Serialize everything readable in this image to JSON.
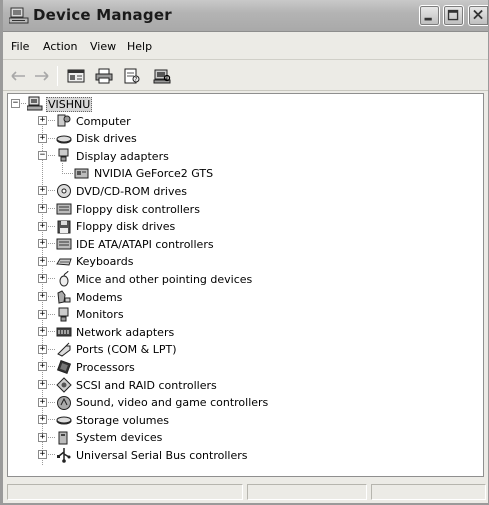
{
  "window": {
    "title": "Device Manager"
  },
  "menu": [
    "File",
    "Action",
    "View",
    "Help"
  ],
  "toolbar": {
    "back_icon": "back-arrow-icon",
    "forward_icon": "forward-arrow-icon",
    "show_hide_tree_icon": "console-tree-icon",
    "print_icon": "printer-icon",
    "properties_icon": "properties-icon",
    "scan_icon": "scan-hardware-icon"
  },
  "tree": {
    "root": "VISHNU",
    "items": [
      {
        "label": "Computer",
        "icon": "computer-icon",
        "expander": "+"
      },
      {
        "label": "Disk drives",
        "icon": "disk-drive-icon",
        "expander": "+"
      },
      {
        "label": "Display adapters",
        "icon": "display-adapter-icon",
        "expander": "−",
        "children": [
          {
            "label": "NVIDIA GeForce2 GTS",
            "icon": "video-card-icon"
          }
        ]
      },
      {
        "label": "DVD/CD-ROM drives",
        "icon": "cdrom-icon",
        "expander": "+"
      },
      {
        "label": "Floppy disk controllers",
        "icon": "controller-icon",
        "expander": "+"
      },
      {
        "label": "Floppy disk drives",
        "icon": "floppy-icon",
        "expander": "+"
      },
      {
        "label": "IDE ATA/ATAPI controllers",
        "icon": "controller-icon",
        "expander": "+"
      },
      {
        "label": "Keyboards",
        "icon": "keyboard-icon",
        "expander": "+"
      },
      {
        "label": "Mice and other pointing devices",
        "icon": "mouse-icon",
        "expander": "+"
      },
      {
        "label": "Modems",
        "icon": "modem-icon",
        "expander": "+"
      },
      {
        "label": "Monitors",
        "icon": "monitor-icon",
        "expander": "+"
      },
      {
        "label": "Network adapters",
        "icon": "network-adapter-icon",
        "expander": "+"
      },
      {
        "label": "Ports (COM & LPT)",
        "icon": "port-icon",
        "expander": "+"
      },
      {
        "label": "Processors",
        "icon": "processor-icon",
        "expander": "+"
      },
      {
        "label": "SCSI and RAID controllers",
        "icon": "scsi-icon",
        "expander": "+"
      },
      {
        "label": "Sound, video and game controllers",
        "icon": "sound-icon",
        "expander": "+"
      },
      {
        "label": "Storage volumes",
        "icon": "storage-icon",
        "expander": "+"
      },
      {
        "label": "System devices",
        "icon": "system-device-icon",
        "expander": "+"
      },
      {
        "label": "Universal Serial Bus controllers",
        "icon": "usb-icon",
        "expander": "+"
      }
    ]
  },
  "colors": {
    "titlebar": "#b4b4b4",
    "selection": "#d8d8d8",
    "pane": "#ffffff",
    "chrome": "#ecebe6"
  }
}
